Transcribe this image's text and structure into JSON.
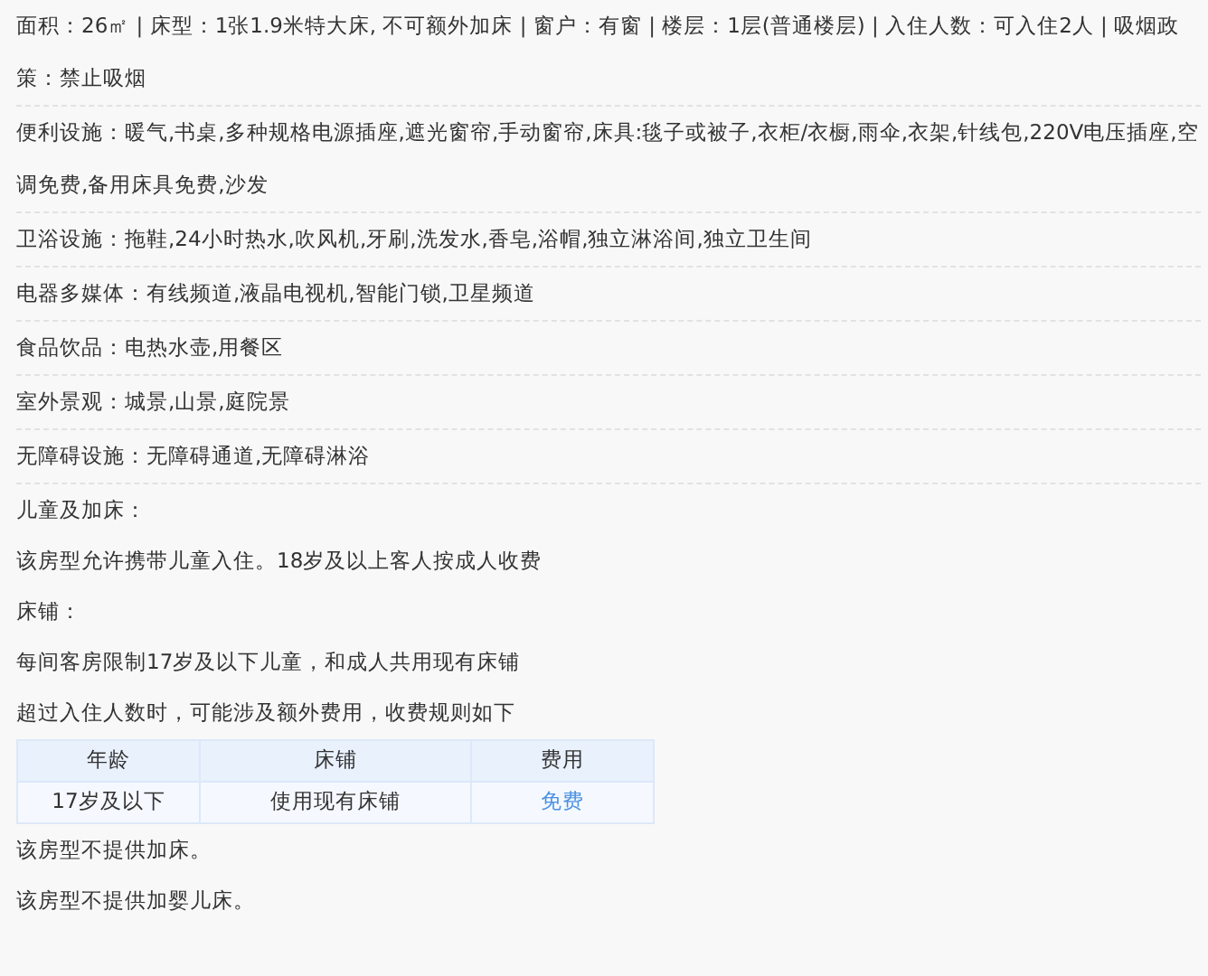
{
  "room_details": [
    {
      "text": "面积：26㎡ | 床型：1张1.9米特大床, 不可额外加床 | 窗户：有窗 | 楼层：1层(普通楼层) | 入住人数：可入住2人 | 吸烟政策：禁止吸烟"
    },
    {
      "text": "便利设施：暖气,书桌,多种规格电源插座,遮光窗帘,手动窗帘,床具:毯子或被子,衣柜/衣橱,雨伞,衣架,针线包,220V电压插座,空调免费,备用床具免费,沙发"
    },
    {
      "text": "卫浴设施：拖鞋,24小时热水,吹风机,牙刷,洗发水,香皂,浴帽,独立淋浴间,独立卫生间"
    },
    {
      "text": "电器多媒体：有线频道,液晶电视机,智能门锁,卫星频道"
    },
    {
      "text": "食品饮品：电热水壶,用餐区"
    },
    {
      "text": "室外景观：城景,山景,庭院景"
    },
    {
      "text": "无障碍设施：无障碍通道,无障碍淋浴"
    }
  ],
  "child_policy": {
    "paragraphs": [
      "儿童及加床：",
      "该房型允许携带儿童入住。18岁及以上客人按成人收费",
      "床铺：",
      "每间客房限制17岁及以下儿童，和成人共用现有床铺",
      "超过入住人数时，可能涉及额外费用，收费规则如下"
    ],
    "table": {
      "columns": [
        "年龄",
        "床铺",
        "费用"
      ],
      "rows": [
        {
          "cells": [
            {
              "text": "17岁及以下",
              "link": false
            },
            {
              "text": "使用现有床铺",
              "link": false
            },
            {
              "text": "免费",
              "link": true
            }
          ]
        }
      ]
    },
    "notes": [
      "该房型不提供加床。",
      "该房型不提供加婴儿床。"
    ]
  }
}
